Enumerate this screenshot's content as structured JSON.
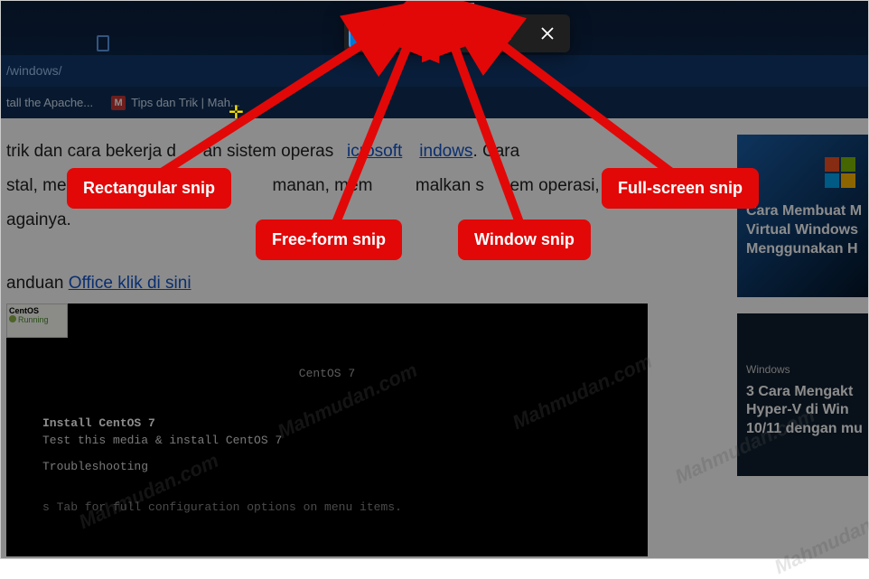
{
  "url": "/windows/",
  "bookmarks": {
    "apache": "tall the Apache...",
    "tips": "Tips dan Trik | Mah..."
  },
  "body": {
    "line1a": " trik dan cara bekerja d",
    "line1b": "an sistem operas",
    "link1": "icrosoft",
    "line1c": "indows",
    "line1d": ". Cara",
    "line2a": "stal, me",
    "line2b": "manan, mem",
    "line2c": "malkan s",
    "line2d": "em operasi,",
    "line3": "againya.",
    "line4a": "anduan ",
    "link2": "Office klik di sini"
  },
  "terminal": {
    "title": "CentOS 7",
    "o1": "Install CentOS 7",
    "o2": "Test this media & install CentOS 7",
    "o3": "Troubleshooting",
    "hint": "s Tab for full configuration options on menu items."
  },
  "centos": {
    "name": "CentOS",
    "status": "Running"
  },
  "sidebar": {
    "card1": {
      "cat": "",
      "title": "Cara Membuat M\nVirtual Windows\nMenggunakan H"
    },
    "card2": {
      "cat": "Windows",
      "title": "3 Cara Mengakt\nHyper-V di Win\n10/11 dengan mu"
    }
  },
  "labels": {
    "rect": "Rectangular snip",
    "free": "Free-form snip",
    "win": "Window snip",
    "full": "Full-screen snip"
  },
  "watermark": "Mahmudan.com"
}
